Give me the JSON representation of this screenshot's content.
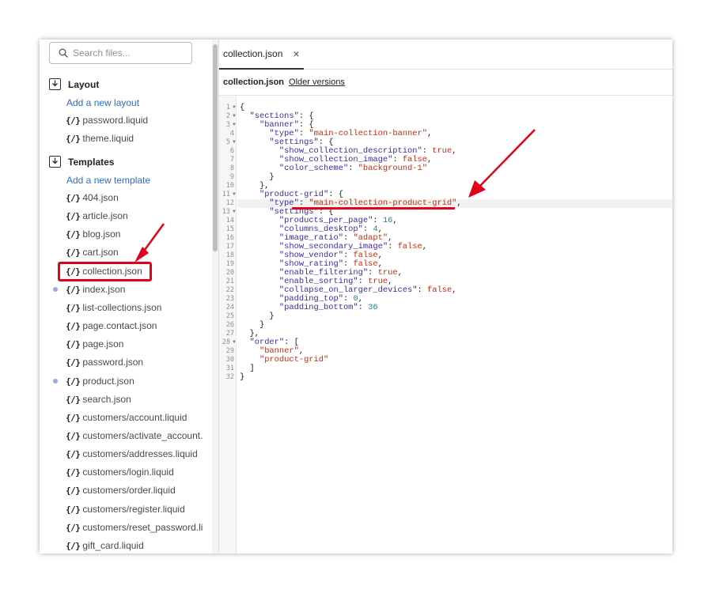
{
  "sidebar": {
    "search_placeholder": "Search files...",
    "sections": [
      {
        "title": "Layout",
        "add_label": "Add a new layout"
      },
      {
        "title": "Templates",
        "add_label": "Add a new template"
      }
    ],
    "layout_files": [
      "password.liquid",
      "theme.liquid"
    ],
    "template_files": [
      "404.json",
      "article.json",
      "blog.json",
      "cart.json",
      "collection.json",
      "index.json",
      "list-collections.json",
      "page.contact.json",
      "page.json",
      "password.json",
      "product.json",
      "search.json",
      "customers/account.liquid",
      "customers/activate_account.",
      "customers/addresses.liquid",
      "customers/login.liquid",
      "customers/order.liquid",
      "customers/register.liquid",
      "customers/reset_password.li",
      "gift_card.liquid"
    ],
    "brace_glyph": "{/}"
  },
  "editor": {
    "tab_label": "collection.json",
    "tab_close": "×",
    "file_name": "collection.json",
    "older_versions": "Older versions"
  },
  "code": {
    "line_numbers": [
      "1",
      "2",
      "3",
      "4",
      "5",
      "6",
      "7",
      "8",
      "9",
      "10",
      "11",
      "12",
      "13",
      "14",
      "15",
      "16",
      "17",
      "18",
      "19",
      "20",
      "21",
      "22",
      "23",
      "24",
      "25",
      "26",
      "27",
      "28",
      "29",
      "30",
      "31",
      "32"
    ]
  },
  "colors": {
    "annotation_red": "#e3001b",
    "link_blue": "#2c6ecb",
    "key_purple": "#3d2aa0",
    "string_red": "#c82b0c",
    "number_teal": "#1a7f8c"
  }
}
